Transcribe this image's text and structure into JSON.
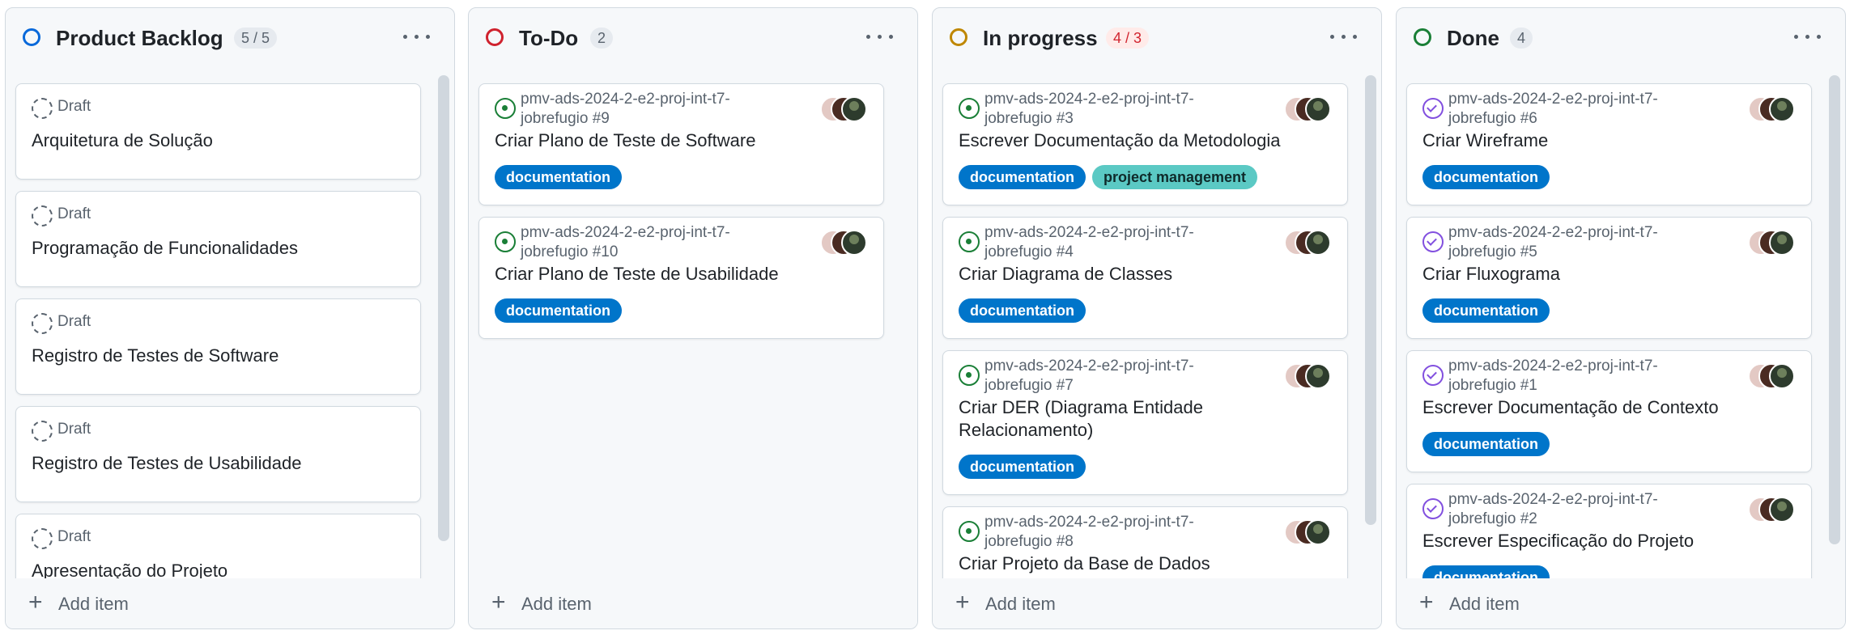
{
  "columns": [
    {
      "title": "Product Backlog",
      "count": "5 / 5",
      "status_color": "#0969da",
      "add_label": "Add item",
      "items": [
        {
          "type": "draft",
          "meta": "Draft",
          "title": "Arquitetura de Solução"
        },
        {
          "type": "draft",
          "meta": "Draft",
          "title": "Programação de Funcionalidades"
        },
        {
          "type": "draft",
          "meta": "Draft",
          "title": "Registro de Testes de Software"
        },
        {
          "type": "draft",
          "meta": "Draft",
          "title": "Registro de Testes de Usabilidade"
        },
        {
          "type": "draft",
          "meta": "Draft",
          "title": "Apresentação do Projeto"
        }
      ]
    },
    {
      "title": "To-Do",
      "count": "2",
      "status_color": "#cf222e",
      "add_label": "Add item",
      "items": [
        {
          "type": "open",
          "ref_line1": "pmv-ads-2024-2-e2-proj-int-t7-",
          "ref_line2": "jobrefugio #9",
          "title": "Criar Plano de Teste de Software",
          "labels": [
            "documentation"
          ]
        },
        {
          "type": "open",
          "ref_line1": "pmv-ads-2024-2-e2-proj-int-t7-",
          "ref_line2": "jobrefugio #10",
          "title": "Criar Plano de Teste de Usabilidade",
          "labels": [
            "documentation"
          ]
        }
      ]
    },
    {
      "title": "In progress",
      "count": "4 / 3",
      "status_color": "#bf8700",
      "add_label": "Add item",
      "items": [
        {
          "type": "open",
          "ref_line1": "pmv-ads-2024-2-e2-proj-int-t7-",
          "ref_line2": "jobrefugio #3",
          "title": "Escrever Documentação da Metodologia",
          "labels": [
            "documentation",
            "project management"
          ]
        },
        {
          "type": "open",
          "ref_line1": "pmv-ads-2024-2-e2-proj-int-t7-",
          "ref_line2": "jobrefugio #4",
          "title": "Criar Diagrama de Classes",
          "labels": [
            "documentation"
          ]
        },
        {
          "type": "open",
          "ref_line1": "pmv-ads-2024-2-e2-proj-int-t7-",
          "ref_line2": "jobrefugio #7",
          "title_line1": "Criar DER (Diagrama Entidade",
          "title_line2": "Relacionamento)",
          "labels": [
            "documentation"
          ]
        },
        {
          "type": "open",
          "ref_line1": "pmv-ads-2024-2-e2-proj-int-t7-",
          "ref_line2": "jobrefugio #8",
          "title": "Criar Projeto da Base de Dados"
        }
      ]
    },
    {
      "title": "Done",
      "count": "4",
      "status_color": "#1a7f37",
      "add_label": "Add item",
      "items": [
        {
          "type": "done",
          "ref_line1": "pmv-ads-2024-2-e2-proj-int-t7-",
          "ref_line2": "jobrefugio #6",
          "title": "Criar Wireframe",
          "labels": [
            "documentation"
          ]
        },
        {
          "type": "done",
          "ref_line1": "pmv-ads-2024-2-e2-proj-int-t7-",
          "ref_line2": "jobrefugio #5",
          "title": "Criar Fluxograma",
          "labels": [
            "documentation"
          ]
        },
        {
          "type": "done",
          "ref_line1": "pmv-ads-2024-2-e2-proj-int-t7-",
          "ref_line2": "jobrefugio #1",
          "title": "Escrever Documentação de Contexto",
          "labels": [
            "documentation"
          ]
        },
        {
          "type": "done",
          "ref_line1": "pmv-ads-2024-2-e2-proj-int-t7-",
          "ref_line2": "jobrefugio #2",
          "title": "Escrever Especificação do Projeto",
          "labels": [
            "documentation"
          ]
        }
      ]
    }
  ]
}
